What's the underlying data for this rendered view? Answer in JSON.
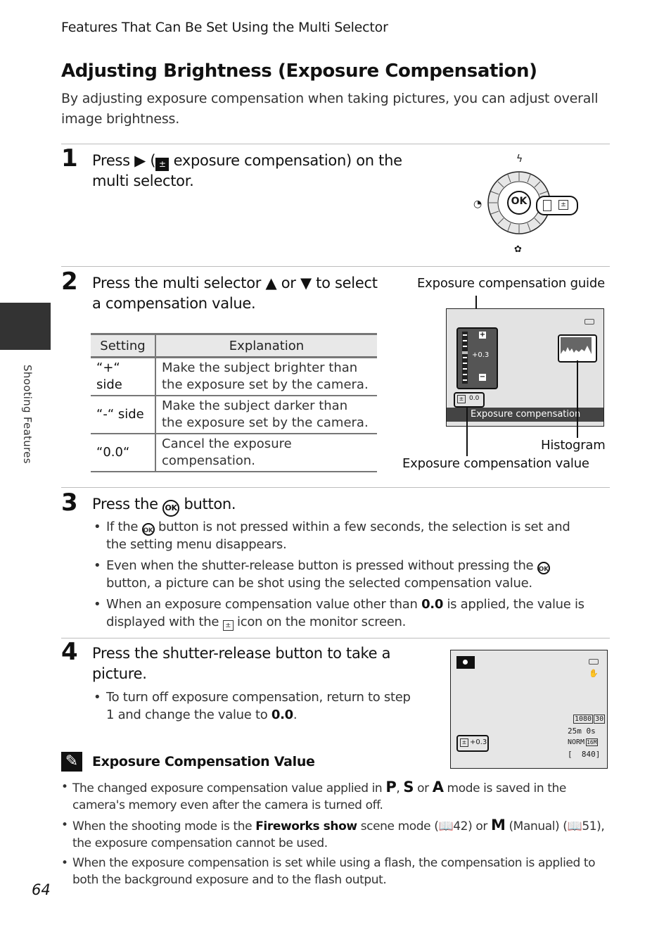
{
  "running_head": "Features That Can Be Set Using the Multi Selector",
  "title": "Adjusting Brightness (Exposure Compensation)",
  "intro": "By adjusting exposure compensation when taking pictures, you can adjust overall image brightness.",
  "side_tab": {
    "label": "Shooting Features"
  },
  "steps": [
    {
      "number": "1",
      "text_before": "Press ▶ (",
      "icon": "exposure-compensation-icon",
      "text_after": " exposure compensation) on the multi selector."
    },
    {
      "number": "2",
      "text": "Press the multi selector ▲ or ▼ to select a compensation value."
    },
    {
      "number": "3",
      "text_before": "Press the ",
      "icon": "ok-button-icon",
      "text_after": " button."
    },
    {
      "number": "4",
      "text": "Press the shutter-release button to take a picture."
    }
  ],
  "multi_selector": {
    "center_label": "OK",
    "top_icon": "flash-icon",
    "left_icon": "self-timer-icon",
    "bottom_icon": "macro-icon",
    "right_icon": "exposure-compensation-icon"
  },
  "table": {
    "headers": [
      "Setting",
      "Explanation"
    ],
    "rows": [
      {
        "setting": "“+“ side",
        "explanation": "Make the subject brighter than the exposure set by the camera."
      },
      {
        "setting": "“-“ side",
        "explanation": "Make the subject darker than the exposure set by the camera."
      },
      {
        "setting": "“0.0“",
        "explanation": "Cancel the exposure compensation."
      }
    ]
  },
  "screen1": {
    "callouts": {
      "guide": "Exposure compensation guide",
      "histogram": "Histogram",
      "value": "Exposure compensation value"
    },
    "guide_value": "+0.3",
    "plus": "+",
    "minus": "−",
    "current_value": "0.0",
    "menu_label": "Exposure compensation"
  },
  "step3_bullets": [
    {
      "before": "If the ",
      "icon": "ok",
      "after": " button is not pressed within a few seconds, the selection is set and the setting menu disappears."
    },
    {
      "before": "Even when the shutter-release button is pressed without pressing the ",
      "icon": "ok",
      "after": " button, a picture can be shot using the selected compensation value."
    },
    {
      "before": "When an exposure compensation value other than ",
      "bold": "0.0",
      "mid": " is applied, the value is displayed with the ",
      "icon": "ev",
      "after": " icon on the monitor screen."
    }
  ],
  "step4_bullet": {
    "before": "To turn off exposure compensation, return to step 1 and change the value to ",
    "bold": "0.0",
    "after": "."
  },
  "screen2": {
    "ev_value": "+0.3",
    "movie_res": "1080",
    "movie_fps": "30",
    "rec_time": "25m 0s",
    "quality": "NORM",
    "image_size": "16M",
    "remaining": "840"
  },
  "note": {
    "title": "Exposure Compensation Value",
    "bullets": [
      {
        "before": "The changed exposure compensation value applied in ",
        "modes": [
          "P",
          "S",
          "A"
        ],
        "after": " mode is saved in the camera's memory even after the camera is turned off."
      },
      {
        "before": "When the shooting mode is the ",
        "bold": "Fireworks show",
        "mid": " scene mode (",
        "ref1": "42",
        "mid2": ") or ",
        "mode": "M",
        "mid3": " (Manual) (",
        "ref2": "51",
        "after": "), the exposure compensation cannot be used."
      },
      {
        "text": "When the exposure compensation is set while using a flash, the compensation is applied to both the background exposure and to the flash output."
      }
    ],
    "mode_sep1": ", ",
    "mode_sep2": " or "
  },
  "page_number": "64"
}
